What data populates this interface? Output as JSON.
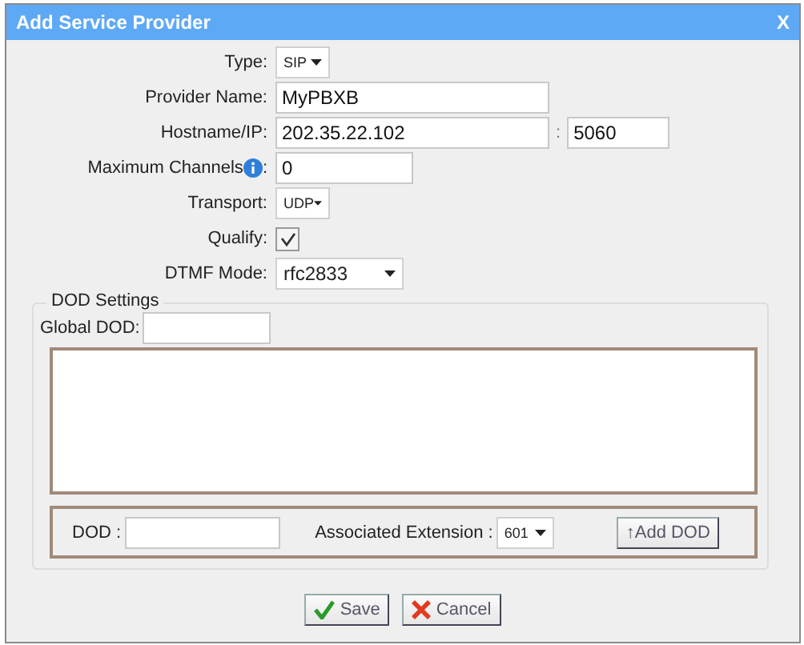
{
  "window": {
    "title": "Add Service Provider",
    "close": "X"
  },
  "form": [
    {
      "kind": "select-small",
      "label": "Type:",
      "value": "SIP"
    },
    {
      "kind": "text",
      "label": "Provider Name:",
      "value": "MyPBXB"
    },
    {
      "kind": "host",
      "label": "Hostname/IP:",
      "value": "202.35.22.102",
      "separator": ":",
      "port": "5060"
    },
    {
      "kind": "number",
      "label": "Maximum Channels",
      "info_icon": true,
      "colon": ":",
      "value": "0"
    },
    {
      "kind": "select-small",
      "label": "Transport:",
      "value": "UDP"
    },
    {
      "kind": "checkbox",
      "label": "Qualify:",
      "checked": true
    },
    {
      "kind": "select-wide",
      "label": "DTMF Mode:",
      "value": "rfc2833"
    }
  ],
  "dod": {
    "legend": "DOD Settings",
    "global_label": "Global DOD:",
    "dod_label": "DOD :",
    "extension_label": "Associated Extension :",
    "extension": "601",
    "add_button": "↑Add DOD"
  },
  "buttons": [
    {
      "kind": "save",
      "label": "Save"
    },
    {
      "kind": "cancel",
      "label": "Cancel"
    }
  ]
}
